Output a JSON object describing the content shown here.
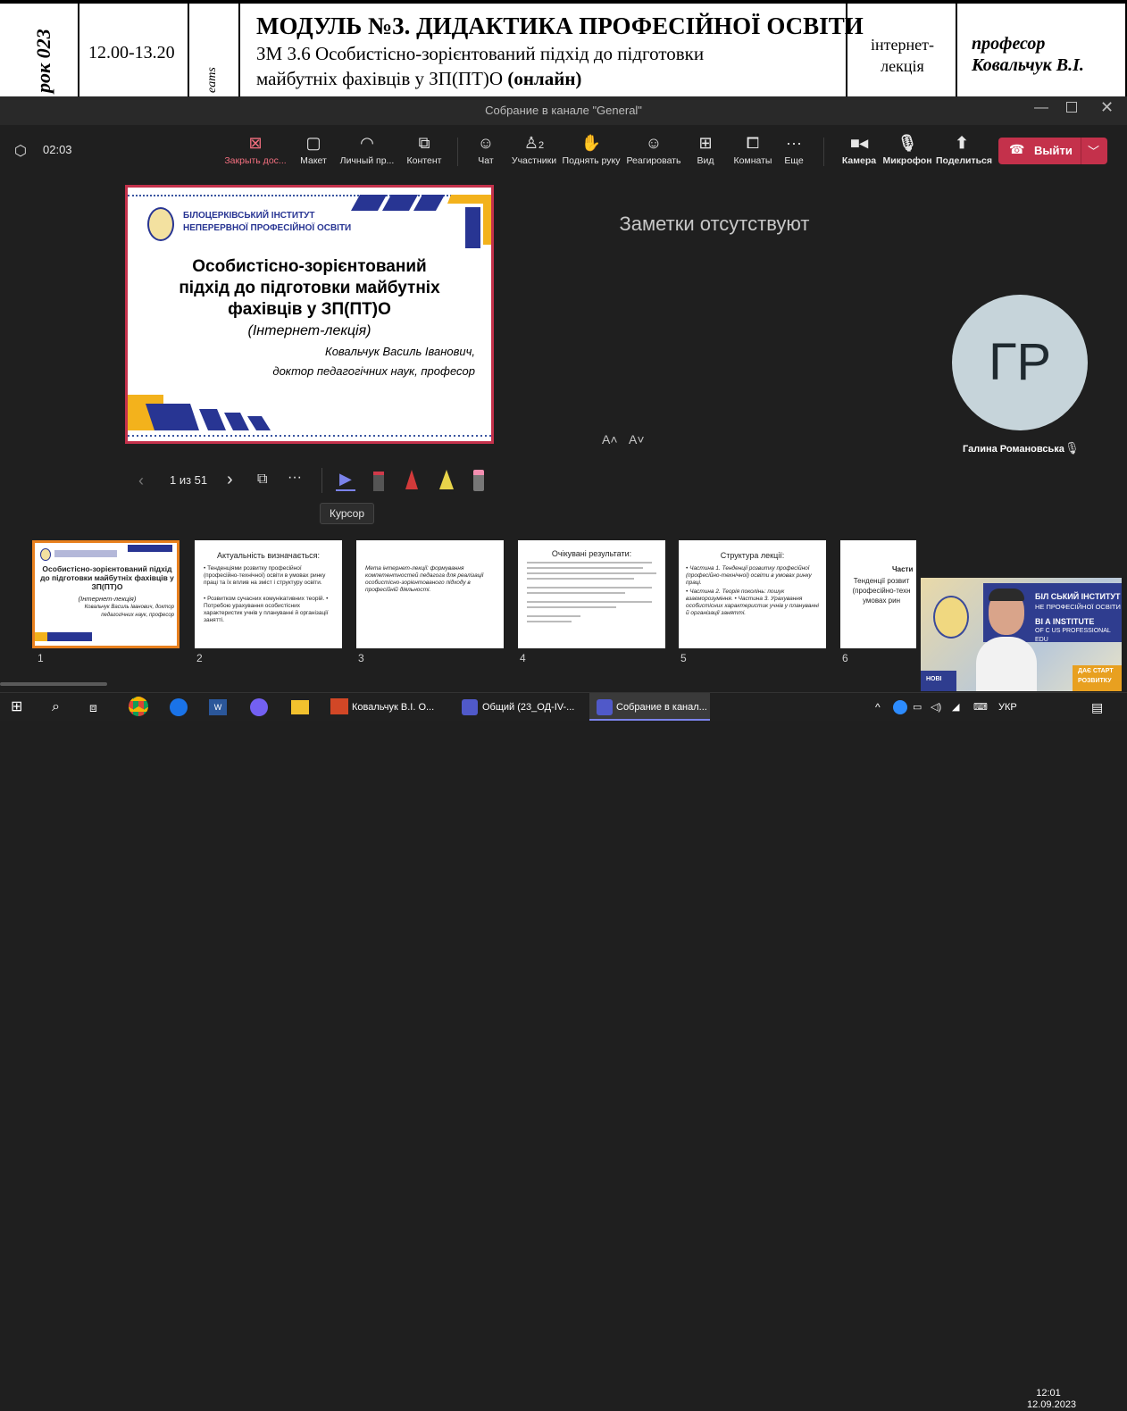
{
  "document_strip": {
    "vertical_left": "рок 023",
    "time": "12.00-13.20",
    "vertical_teams": "eams",
    "module_title": "МОДУЛЬ №3. ДИДАКТИКА ПРОФЕСІЙНОЇ ОСВІТИ",
    "topic_line1": "ЗМ 3.6 Особистісно-зорієнтований підхід до підготовки",
    "topic_line2": "майбутніх фахівців у ЗП(ПТ)О",
    "topic_bold": "(онлайн)",
    "format_line1": "інтернет-",
    "format_line2": "лекція",
    "lecturer_line1": "професор",
    "lecturer_line2": "Ковальчук В.І."
  },
  "window": {
    "title": "Собрание в канале \"General\""
  },
  "toolbar": {
    "timer": "02:03",
    "close_content": "Закрыть дос...",
    "layout": "Макет",
    "personal": "Личный пр...",
    "content": "Контент",
    "chat": "Чат",
    "participants": "Участники",
    "participants_count": "2",
    "raise_hand": "Поднять руку",
    "react": "Реагировать",
    "view": "Вид",
    "rooms": "Комнаты",
    "more": "Еще",
    "camera": "Камера",
    "mic": "Микрофон",
    "share": "Поделиться",
    "leave": "Выйти",
    "colors": {
      "leave": "#c4314b",
      "accent": "#e0e0e0"
    }
  },
  "slide": {
    "institute_line1": "БІЛОЦЕРКІВСЬКИЙ ІНСТИТУТ",
    "institute_line2": "НЕПЕРЕРВНОЇ ПРОФЕСІЙНОЇ ОСВІТИ",
    "title_line1": "Особистісно-зорієнтований",
    "title_line2": "підхід до підготовки майбутніх",
    "title_line3": "фахівців у ЗП(ПТ)О",
    "subtitle": "(Інтернет-лекція)",
    "author": "Ковальчук Василь Іванович,",
    "degree": "доктор педагогічних наук, професор"
  },
  "presenter_controls": {
    "page": "1 из 51",
    "tooltip": "Курсор"
  },
  "notes": {
    "empty_text": "Заметки отсутствуют",
    "font_up": "A˄",
    "font_down": "A˅"
  },
  "participant": {
    "initials": "ГР",
    "name": "Галина Романовська"
  },
  "thumbnails": [
    {
      "num": "1",
      "title": "Особистісно-зорієнтований підхід до підготовки майбутніх фахівців у ЗП(ПТ)О",
      "sub": "(Інтернет-лекція)",
      "extra": "Ковальчук Василь Іванович, доктор педагогічних наук, професор"
    },
    {
      "num": "2",
      "title": "Актуальність визначається:",
      "sub": "• Тенденціями розвитку професійної (професійно-технічної) освіти в умовах ринку праці та їх вплив на зміст і структуру освіти.",
      "extra": "• Розвитком сучасних комунікативних теорій. • Потребою урахування особистісних характеристик учнів у плануванні й організації занятті."
    },
    {
      "num": "3",
      "title": "",
      "sub": "Мета інтернет-лекції: формування компетентностей педагога для реалізації особистісно-зорієнтованого підходу в професійній діяльності.",
      "extra": ""
    },
    {
      "num": "4",
      "title": "Очікувані результати:",
      "sub": "",
      "extra": ""
    },
    {
      "num": "5",
      "title": "Структура лекції:",
      "sub": "• Частина 1. Тенденції розвитку професійної (професійно-технічної) освіти в умовах ринку праці.",
      "extra": "• Частина 2. Теорія поколінь: пошук взаєморозуміння. • Частина 3. Урахування особистісних характеристик учнів у плануванні й організації занятті."
    },
    {
      "num": "6",
      "title": "Части",
      "sub": "Тенденції розвит (професійно-техн умовах рин",
      "extra": ""
    }
  ],
  "video_overlay": {
    "banner_line1": "БІЛ СЬКИЙ ІНСТИТУТ",
    "banner_line2": "НЕ ПРОФЕСІЙНОЇ ОСВІТИ",
    "banner_line3": "BI A INSTITUTE",
    "banner_line4": "OF C US PROFESSIONAL",
    "banner_line5": "EDU",
    "ribbon": "ДАЄ СТАРТ",
    "ribbon2": "РОЗВИТКУ",
    "new": "НОВІ"
  },
  "taskbar": {
    "task1": "Ковальчук В.І. О...",
    "task2": "Общий (23_ОД-IV-...",
    "task3": "Собрание в канал...",
    "lang": "УКР",
    "time": "12:01",
    "date": "12.09.2023"
  }
}
